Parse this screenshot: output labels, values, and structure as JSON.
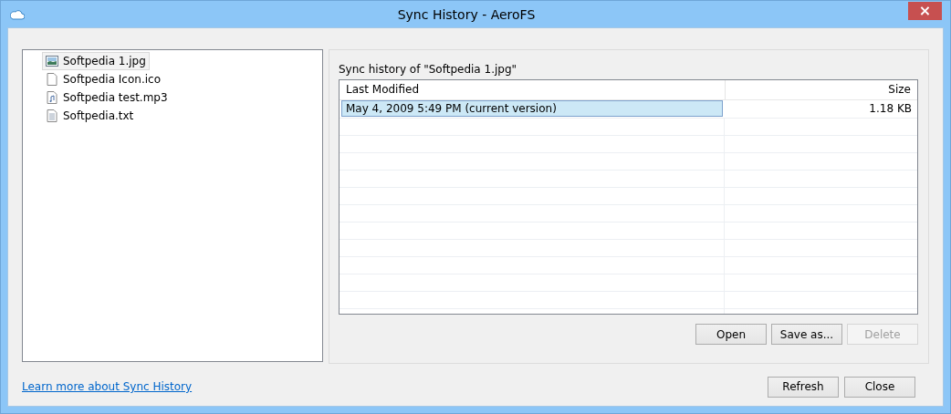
{
  "window": {
    "title": "Sync History - AeroFS",
    "close": "×"
  },
  "files": [
    {
      "name": "Softpedia 1.jpg",
      "kind": "image",
      "selected": true
    },
    {
      "name": "Softpedia Icon.ico",
      "kind": "blank",
      "selected": false
    },
    {
      "name": "Softpedia test.mp3",
      "kind": "audio",
      "selected": false
    },
    {
      "name": "Softpedia.txt",
      "kind": "text",
      "selected": false
    }
  ],
  "history": {
    "caption": "Sync history of \"Softpedia 1.jpg\"",
    "columns": [
      "Last Modified",
      "Size"
    ],
    "rows": [
      {
        "modified": "May 4, 2009 5:49 PM (current version)",
        "size": "1.18 KB",
        "selected": true
      }
    ],
    "buttons": [
      {
        "label": "Open",
        "disabled": false
      },
      {
        "label": "Save as...",
        "disabled": false
      },
      {
        "label": "Delete",
        "disabled": true
      }
    ]
  },
  "link": "Learn more about Sync History",
  "buttons": [
    {
      "label": "Refresh",
      "disabled": false
    },
    {
      "label": "Close",
      "disabled": false
    }
  ]
}
